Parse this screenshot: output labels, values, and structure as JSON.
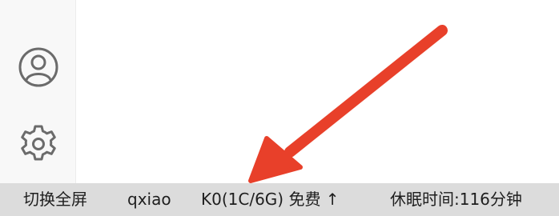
{
  "activity_bar": {
    "icons": [
      "account-icon",
      "gear-icon"
    ]
  },
  "status_bar": {
    "fullscreen": "切换全屏",
    "user": "qxiao",
    "kernel": "K0(1C/6G) 免费 ↑",
    "sleep": "休眠时间:116分钟"
  },
  "colors": {
    "activity_bar_bg": "#f8f8f8",
    "status_bar_bg": "#dcdcdc",
    "icon_stroke": "#6b6b6b",
    "arrow": "#e8402a"
  }
}
